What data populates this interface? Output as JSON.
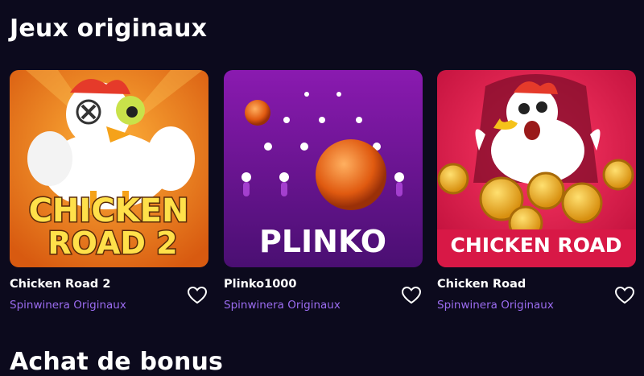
{
  "sections": {
    "originals_title": "Jeux originaux",
    "bonus_title": "Achat de bonus"
  },
  "games": [
    {
      "name": "Chicken Road 2",
      "provider": "Spinwinera Originaux",
      "art_text_line1": "CHICKEN",
      "art_text_line2": "ROAD 2",
      "favorite_icon": "heart-outline-icon"
    },
    {
      "name": "Plinko1000",
      "provider": "Spinwinera Originaux",
      "art_text_line1": "PLINKO",
      "favorite_icon": "heart-outline-icon"
    },
    {
      "name": "Chicken Road",
      "provider": "Spinwinera Originaux",
      "art_text_line1": "CHICKEN ROAD",
      "favorite_icon": "heart-outline-icon"
    }
  ],
  "colors": {
    "background": "#0c0a1d",
    "provider_text": "#9b6cf0",
    "plinko_bg": "#6a1a9a",
    "chicken_road_bg": "#e0204e",
    "chicken_road_2_bg": "#e87a1a"
  }
}
